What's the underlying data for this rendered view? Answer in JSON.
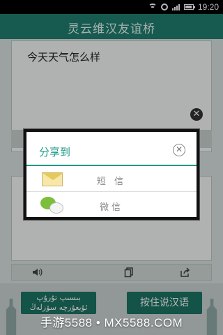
{
  "status_bar": {
    "time": "19:20"
  },
  "app": {
    "title": "灵云维汉友谊桥"
  },
  "input_panel": {
    "text": "今天天气怎么样"
  },
  "buttons": {
    "uyghur_line1": "بىسىپ تۇرۇپ",
    "uyghur_line2": "ئۇيغۇرچە سۆزلەڭ",
    "chinese": "按住说汉语"
  },
  "share_dialog": {
    "title": "分享到",
    "options": [
      {
        "icon": "sms-envelope-icon",
        "label": "短 信"
      },
      {
        "icon": "wechat-icon",
        "label": "微信"
      }
    ]
  },
  "watermark": "手游5588 • MX5588.COM",
  "colors": {
    "accent": "#1e9a86",
    "title_bar": "#1f7d6f",
    "button": "#1d7463"
  }
}
